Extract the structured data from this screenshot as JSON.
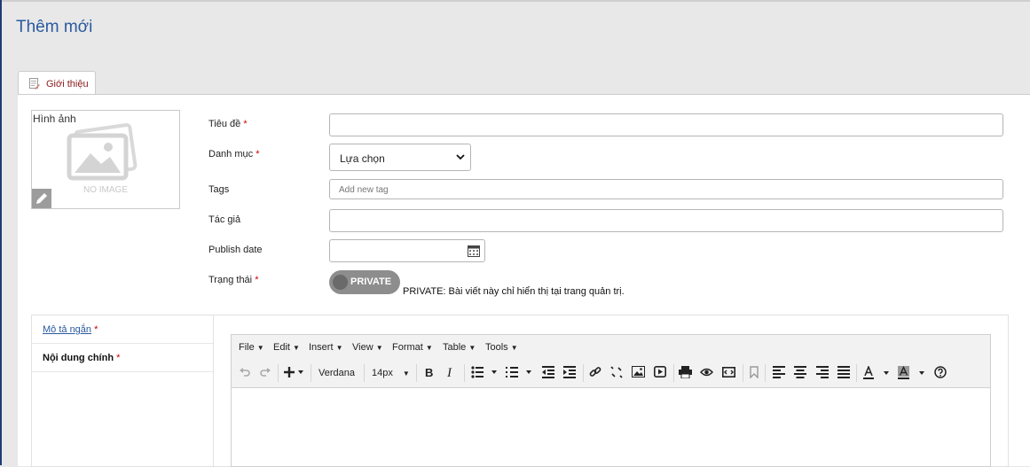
{
  "page": {
    "title": "Thêm mới"
  },
  "tabs": [
    {
      "label": "Giới thiệu"
    }
  ],
  "image": {
    "alt": "Hình ảnh",
    "placeholder_text": "NO IMAGE"
  },
  "form": {
    "title_label": "Tiêu đề",
    "category_label": "Danh mục",
    "category_value": "Lựa chọn",
    "tags_label": "Tags",
    "tags_placeholder": "Add new tag",
    "author_label": "Tác giả",
    "publish_label": "Publish date",
    "status_label": "Trạng thái",
    "status_toggle": "PRIVATE",
    "status_desc": "PRIVATE: Bài viết này chỉ hiển thị tại trang quản trị.",
    "required_mark": "*"
  },
  "sidenav": [
    {
      "label": "Mô tả ngắn"
    },
    {
      "label": "Nội dung chính"
    }
  ],
  "editor": {
    "menus": [
      "File",
      "Edit",
      "Insert",
      "View",
      "Format",
      "Table",
      "Tools"
    ],
    "font_family": "Verdana",
    "font_size": "14px"
  },
  "colors": {
    "title_blue": "#2a5a9f",
    "toggle_gray": "#8d8d8d",
    "required_red": "#cc0000"
  }
}
